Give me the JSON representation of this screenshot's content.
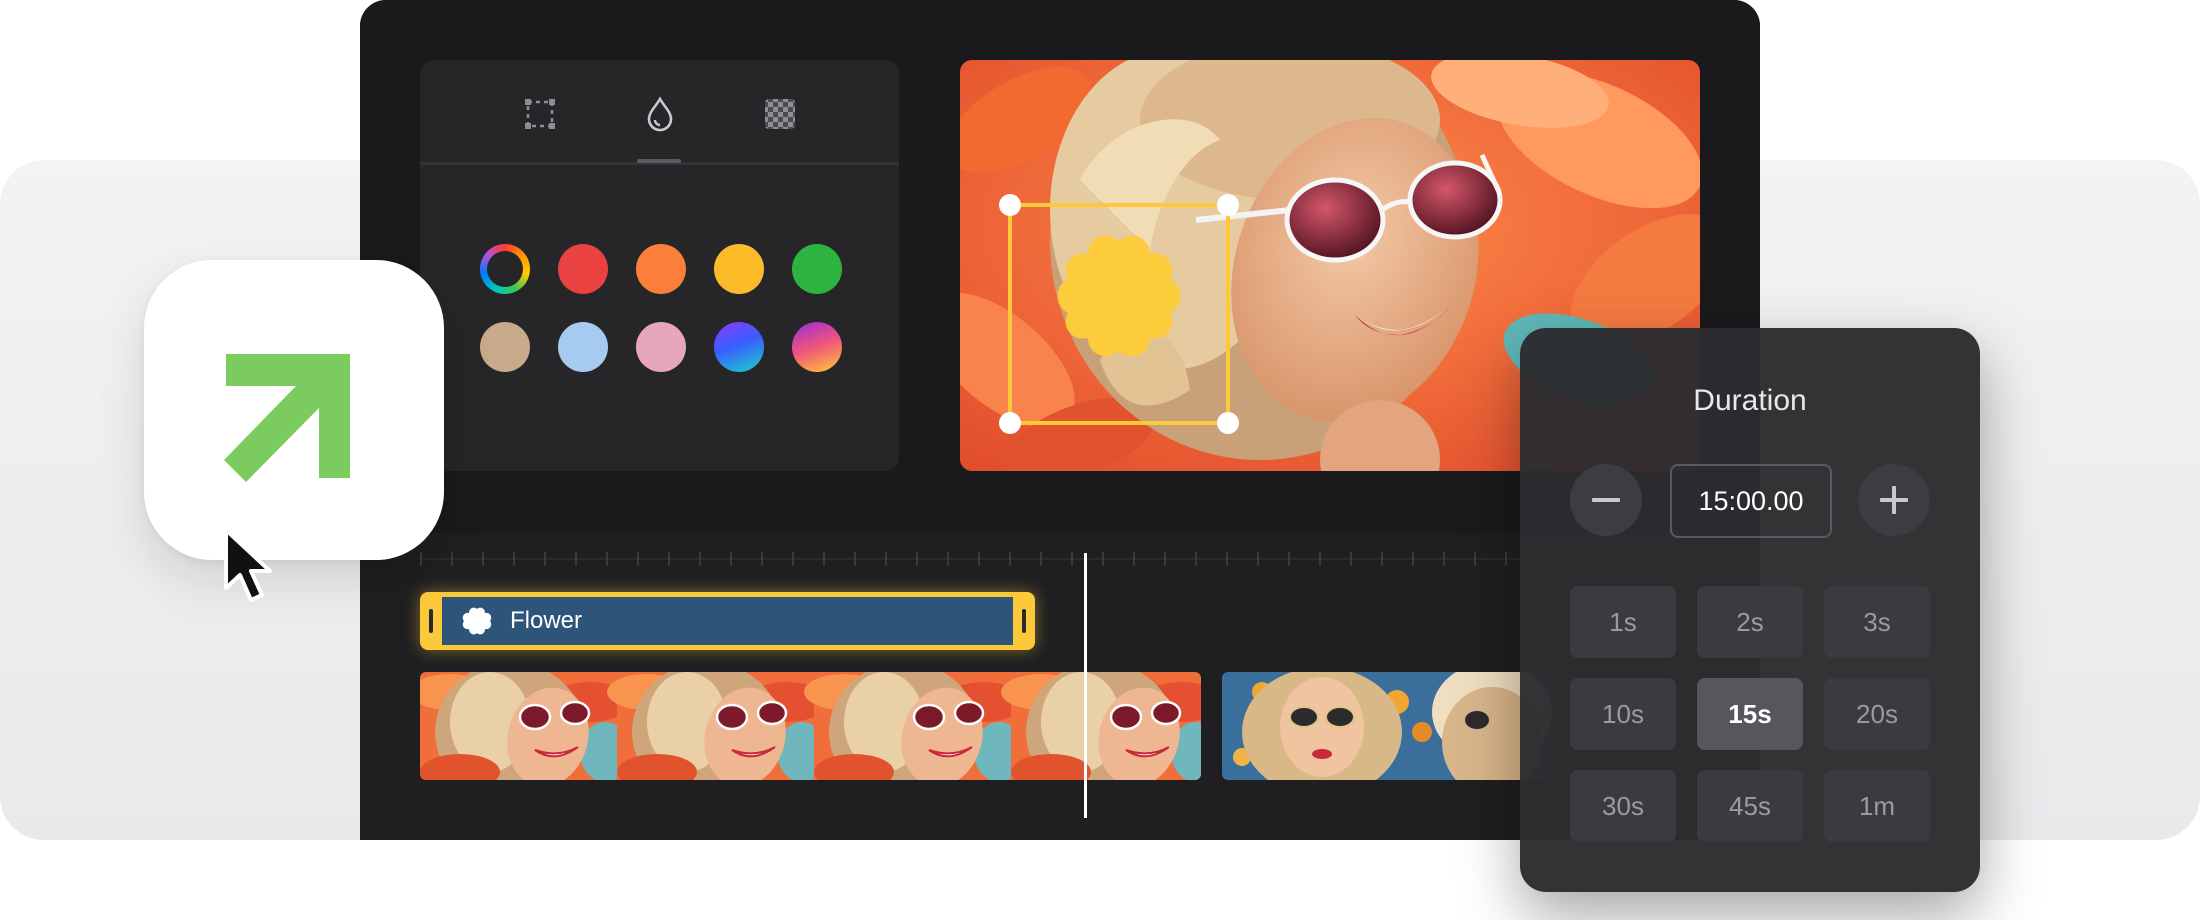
{
  "tools": {
    "tabs": [
      {
        "name": "crop-icon"
      },
      {
        "name": "drop-icon",
        "active": true
      },
      {
        "name": "transparency-icon"
      }
    ],
    "swatches": [
      {
        "name": "color-wheel",
        "color": "conic"
      },
      {
        "name": "red",
        "color": "#ea4141"
      },
      {
        "name": "orange",
        "color": "#fb7f3a"
      },
      {
        "name": "yellow",
        "color": "#fcbc2a"
      },
      {
        "name": "green",
        "color": "#2db33f"
      },
      {
        "name": "tan",
        "color": "#c6aa8a"
      },
      {
        "name": "light-blue",
        "color": "#a6cbf0"
      },
      {
        "name": "pink",
        "color": "#e8a6bb"
      },
      {
        "name": "purple-blue-gradient",
        "color": "gradient-1"
      },
      {
        "name": "purple-orange-gradient",
        "color": "gradient-2"
      }
    ]
  },
  "preview": {
    "sticker": {
      "name": "flower-sticker",
      "color": "#fdcc3d"
    },
    "selection_color": "#fcc93a"
  },
  "timeline": {
    "clip_label": "Flower",
    "clip_color": "#2d5479",
    "clip_border": "#fcc93a"
  },
  "app_icon": {
    "arrow_color": "#7ccb5f"
  },
  "duration_panel": {
    "title": "Duration",
    "value": "15:00.00",
    "presets": [
      "1s",
      "2s",
      "3s",
      "10s",
      "15s",
      "20s",
      "30s",
      "45s",
      "1m"
    ],
    "selected_preset": "15s"
  }
}
